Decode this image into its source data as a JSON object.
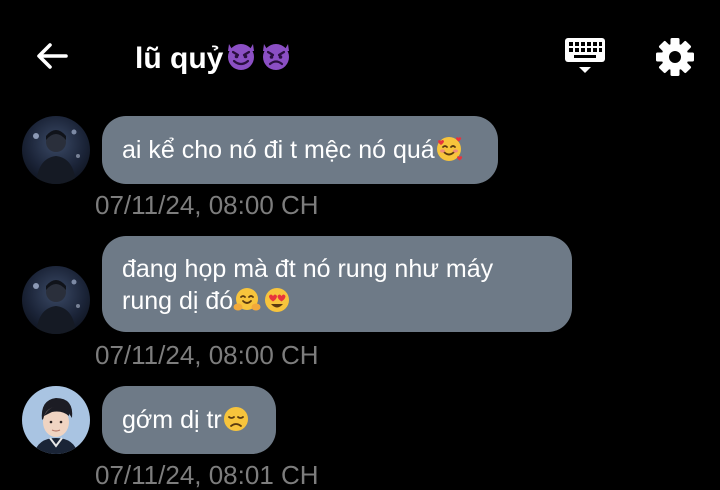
{
  "header": {
    "title": "lũ quỷ",
    "title_emoji": [
      "smiling-devil",
      "angry-devil"
    ]
  },
  "messages": [
    {
      "text": "ai kể cho nó đi t mệc nó quá",
      "emoji": [
        "smiling-face-with-hearts"
      ],
      "time": "07/11/24, 08:00 CH"
    },
    {
      "line1": "đang họp mà đt nó rung như máy",
      "line2": "rung dị đó",
      "emoji": [
        "hugging-face",
        "heart-eyes"
      ],
      "time": "07/11/24, 08:00 CH"
    },
    {
      "text": "gớm dị tr",
      "emoji": [
        "disappointed-face"
      ],
      "time": "07/11/24, 08:01 CH"
    }
  ],
  "colors": {
    "background": "#000000",
    "bubble": "#6e7a87",
    "timestamp": "#7d7d7d",
    "devil": "#8b4fc4"
  }
}
